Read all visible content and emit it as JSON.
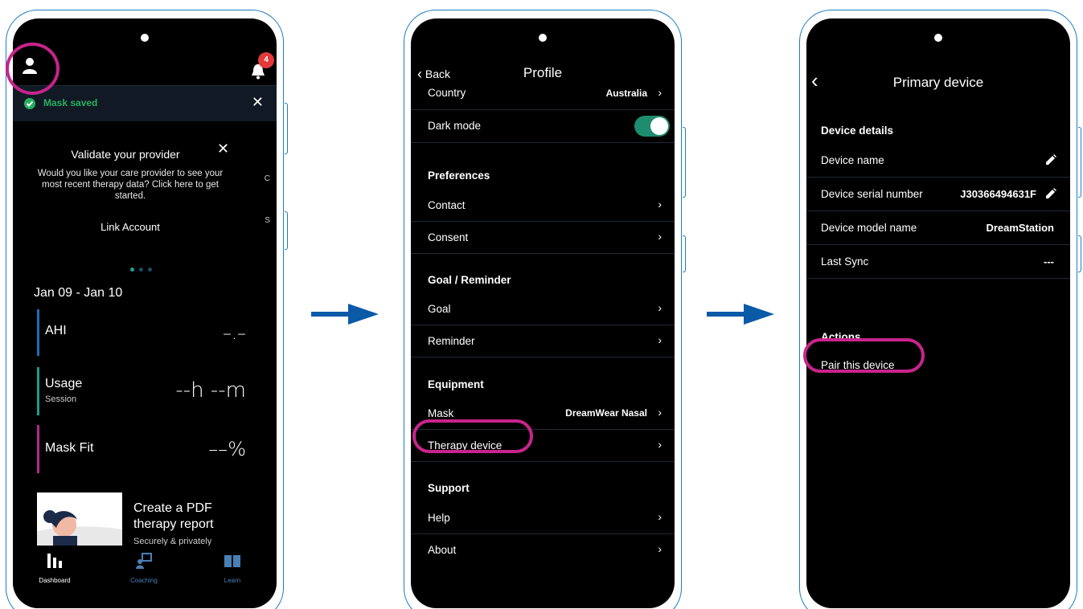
{
  "colors": {
    "accent_magenta": "#c8248c",
    "arrow_blue": "#0a5aa8",
    "phone_outline": "#1f7cc2",
    "success_green": "#27ae60",
    "toggle_green": "#1e8c6e",
    "badge_red": "#e23a3a"
  },
  "screen1": {
    "notification_count": "4",
    "toast": {
      "text": "Mask saved",
      "close": "✕"
    },
    "card": {
      "title": "Validate your provider",
      "close": "✕",
      "body": "Would you like your care provider to see your most recent therapy data?  Click here to get started.",
      "link": "Link Account",
      "peek1": "C",
      "peek2": "S"
    },
    "date_range": "Jan 09 - Jan 10",
    "metrics": [
      {
        "name": "AHI",
        "sub": "",
        "value": "–.–",
        "color": "#1a6fb5"
      },
      {
        "name": "Usage",
        "sub": "Session",
        "value": "--h --m",
        "color": "#1a9c8c"
      },
      {
        "name": "Mask Fit",
        "sub": "",
        "value": "––%",
        "color": "#b02a8a"
      }
    ],
    "promo": {
      "title_line1": "Create a PDF",
      "title_line2": "therapy report",
      "subtitle": "Securely & privately"
    },
    "tabs": [
      {
        "label": "Dashboard",
        "icon": "bar-chart-icon"
      },
      {
        "label": "Coaching",
        "icon": "coaching-icon"
      },
      {
        "label": "Learn",
        "icon": "book-icon"
      }
    ]
  },
  "screen2": {
    "back": "Back",
    "title": "Profile",
    "country": {
      "label": "Country",
      "value": "Australia"
    },
    "dark_mode": {
      "label": "Dark mode",
      "on": true
    },
    "sections": {
      "preferences": "Preferences",
      "goal": "Goal / Reminder",
      "equipment": "Equipment",
      "support": "Support"
    },
    "items": {
      "contact": "Contact",
      "consent": "Consent",
      "goal": "Goal",
      "reminder": "Reminder",
      "mask": "Mask",
      "mask_value": "DreamWear Nasal",
      "therapy_device": "Therapy device",
      "help": "Help",
      "about": "About"
    },
    "chevron": "›"
  },
  "screen3": {
    "title": "Primary device",
    "back": "‹",
    "details_header": "Device details",
    "rows": {
      "name": {
        "label": "Device name",
        "value": ""
      },
      "serial": {
        "label": "Device serial number",
        "value": "J30366494631F"
      },
      "model": {
        "label": "Device model name",
        "value": "DreamStation"
      },
      "sync": {
        "label": "Last Sync",
        "value": "---"
      }
    },
    "actions_header": "Actions",
    "pair": "Pair this device"
  }
}
